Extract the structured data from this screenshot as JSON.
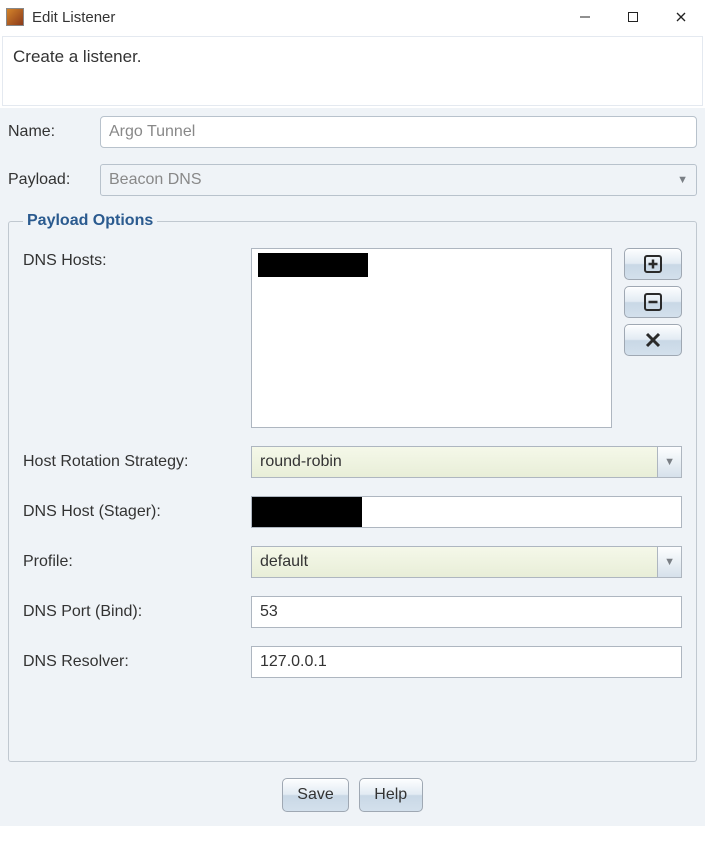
{
  "window": {
    "title": "Edit Listener",
    "minimize": "—",
    "maximize": "☐",
    "close": "✕"
  },
  "description": "Create a listener.",
  "top_form": {
    "name_label": "Name:",
    "name_value": "Argo Tunnel",
    "payload_label": "Payload:",
    "payload_value": "Beacon DNS"
  },
  "payload_options": {
    "legend": "Payload Options",
    "dns_hosts_label": "DNS Hosts:",
    "dns_hosts_items": [
      "[redacted]"
    ],
    "host_rotation_label": "Host Rotation Strategy:",
    "host_rotation_value": "round-robin",
    "dns_host_stager_label": "DNS Host (Stager):",
    "dns_host_stager_value": "[redacted]",
    "profile_label": "Profile:",
    "profile_value": "default",
    "dns_port_label": "DNS Port (Bind):",
    "dns_port_value": "53",
    "dns_resolver_label": "DNS Resolver:",
    "dns_resolver_value": "127.0.0.1"
  },
  "buttons": {
    "save": "Save",
    "help": "Help"
  }
}
